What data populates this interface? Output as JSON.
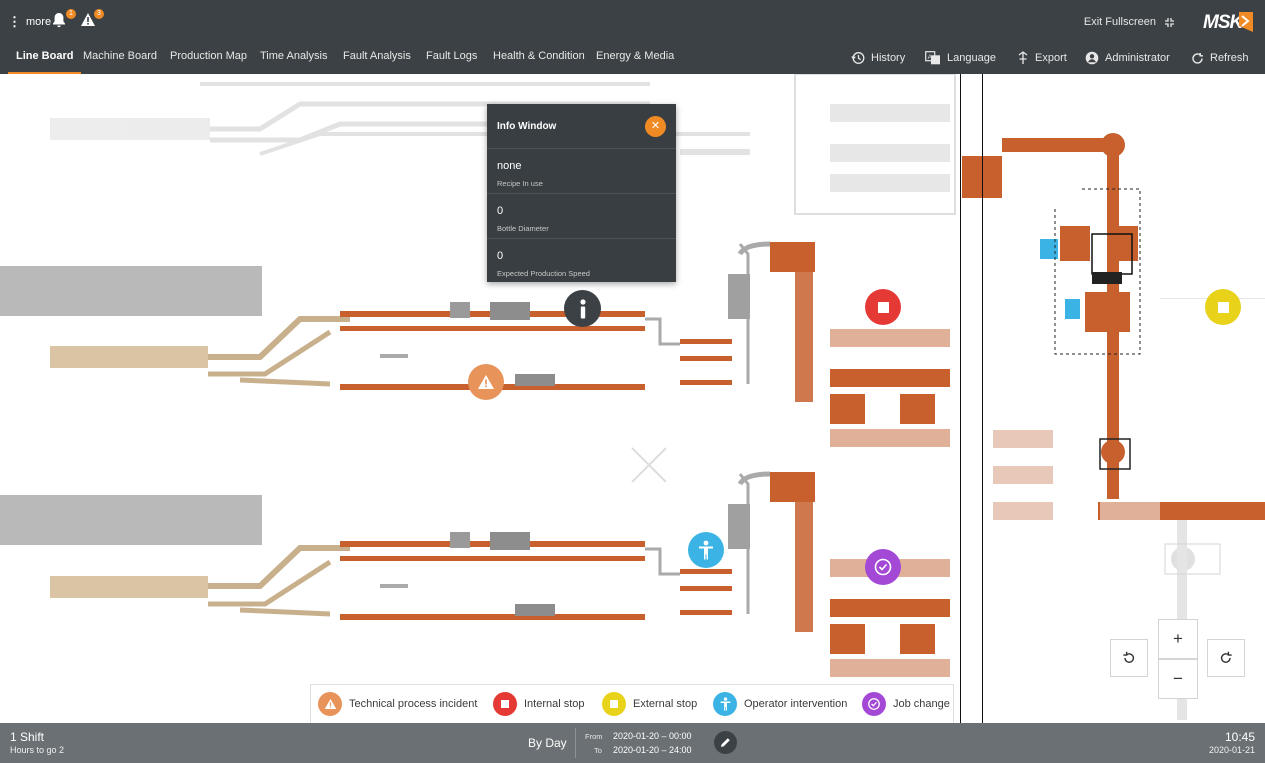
{
  "header": {
    "more_label": "more",
    "notification_count": "1",
    "warning_count": "3",
    "exit_fullscreen_label": "Exit Fullscreen",
    "logo_text": "MSK"
  },
  "nav": {
    "tabs": [
      {
        "label": "Line Board",
        "active": true
      },
      {
        "label": "Machine Board"
      },
      {
        "label": "Production Map"
      },
      {
        "label": "Time Analysis"
      },
      {
        "label": "Fault Analysis"
      },
      {
        "label": "Fault Logs"
      },
      {
        "label": "Health & Condition"
      },
      {
        "label": "Energy & Media"
      }
    ],
    "actions": [
      {
        "label": "History",
        "icon": "history-icon"
      },
      {
        "label": "Language",
        "icon": "language-icon"
      },
      {
        "label": "Export",
        "icon": "export-icon"
      },
      {
        "label": "Administrator",
        "icon": "user-icon"
      },
      {
        "label": "Refresh",
        "icon": "refresh-icon"
      }
    ]
  },
  "info_window": {
    "title": "Info Window",
    "rows": [
      {
        "value": "none",
        "label": "Recipe In use"
      },
      {
        "value": "0",
        "label": "Bottle Diameter"
      },
      {
        "value": "0",
        "label": "Expected Production Speed"
      }
    ]
  },
  "legend": {
    "items": [
      {
        "label": "Technical process incident",
        "color": "#e8935a",
        "icon": "warning-icon"
      },
      {
        "label": "Internal stop",
        "color": "#e53935",
        "icon": "stop-icon"
      },
      {
        "label": "External stop",
        "color": "#e8d21a",
        "icon": "stop-icon"
      },
      {
        "label": "Operator intervention",
        "color": "#3bb4e5",
        "icon": "person-icon"
      },
      {
        "label": "Job change",
        "color": "#a349d6",
        "icon": "job-change-icon"
      }
    ]
  },
  "footer": {
    "shift": "1 Shift",
    "hours_to_go": "Hours to go 2",
    "period": "By Day",
    "from_label": "From",
    "to_label": "To",
    "from_value": "2020-01-20 – 00:00",
    "to_value": "2020-01-20 – 24:00",
    "time": "10:45",
    "date": "2020-01-21"
  },
  "colors": {
    "header_bg": "#3b4144",
    "accent": "#f08a24",
    "footer_bg": "#6a7073",
    "machine_orange": "#c8602e",
    "conveyor_tan": "#d9c4a4"
  }
}
